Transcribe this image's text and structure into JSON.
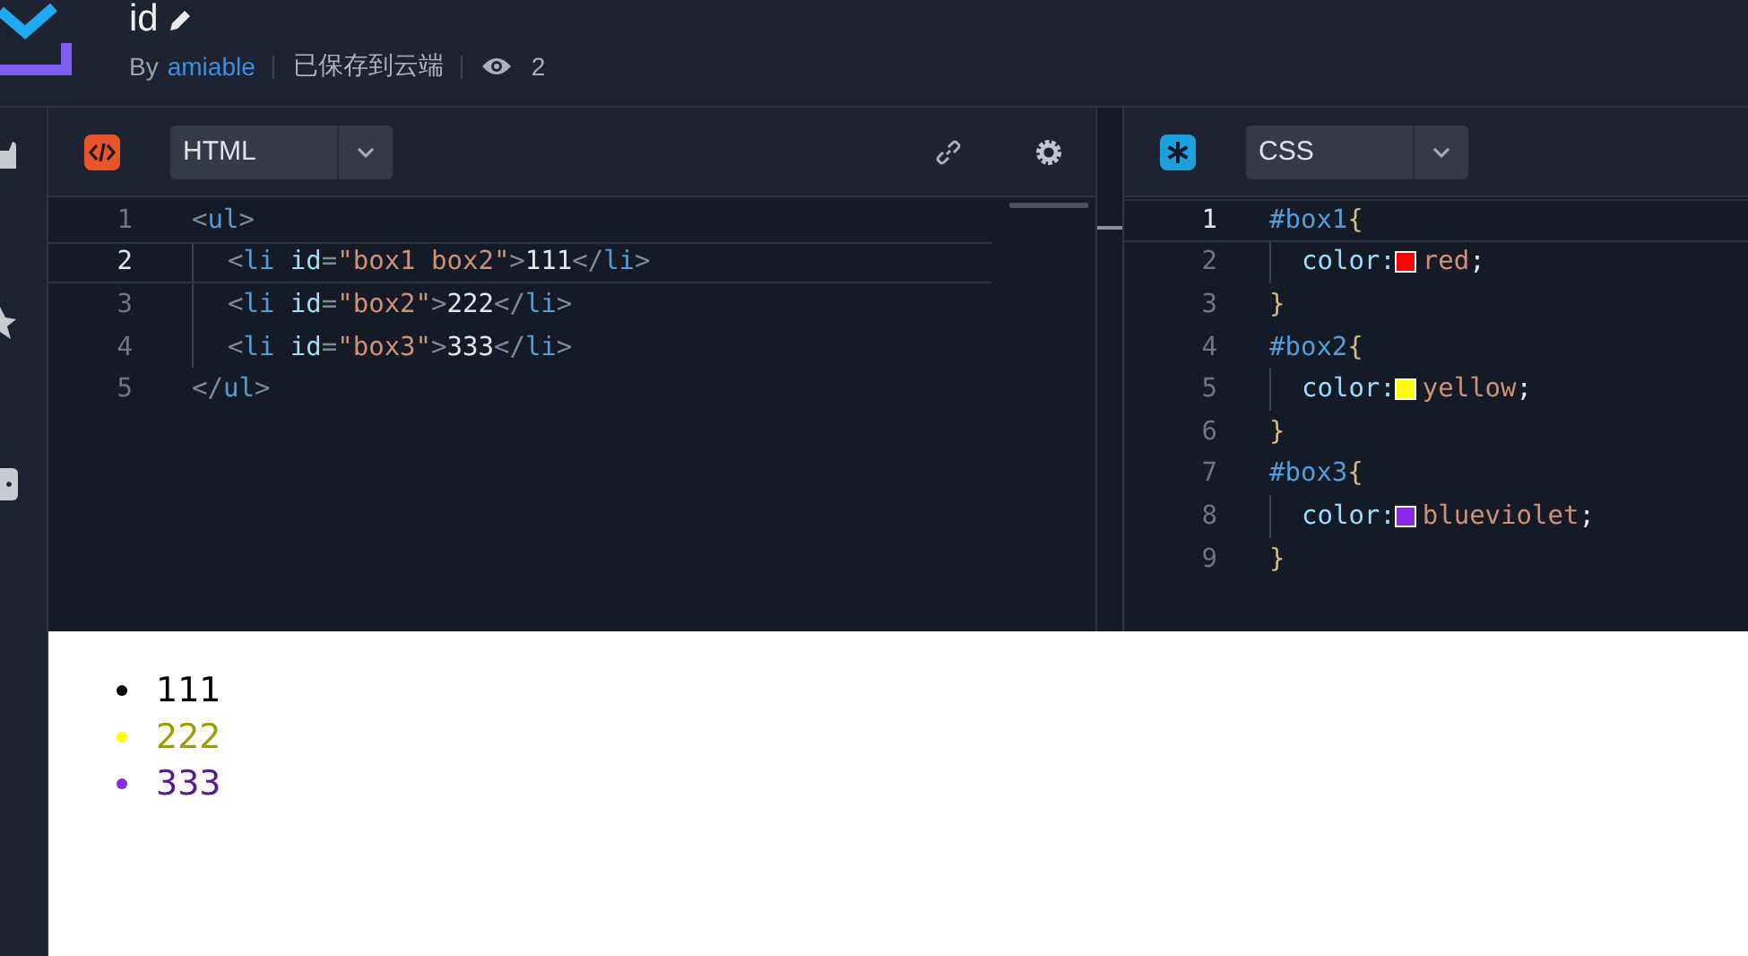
{
  "header": {
    "title": "id",
    "by_label": "By",
    "author": "amiable",
    "save_status": "已保存到云端",
    "views": "2"
  },
  "html_pane": {
    "language": "HTML",
    "lines": [
      {
        "number": "1",
        "active": false,
        "indented": false,
        "tokens": [
          {
            "kind": "punct",
            "text": "<"
          },
          {
            "kind": "tag",
            "text": "ul"
          },
          {
            "kind": "punct",
            "text": ">"
          }
        ]
      },
      {
        "number": "2",
        "active": true,
        "indented": true,
        "tokens": [
          {
            "kind": "punct",
            "text": "<"
          },
          {
            "kind": "tag",
            "text": "li"
          },
          {
            "kind": "attr",
            "text": " id"
          },
          {
            "kind": "punct",
            "text": "="
          },
          {
            "kind": "str",
            "text": "\"box1 box2\""
          },
          {
            "kind": "punct",
            "text": ">"
          },
          {
            "kind": "text",
            "text": "111"
          },
          {
            "kind": "punct",
            "text": "</"
          },
          {
            "kind": "tag",
            "text": "li"
          },
          {
            "kind": "punct",
            "text": ">"
          }
        ]
      },
      {
        "number": "3",
        "active": false,
        "indented": true,
        "tokens": [
          {
            "kind": "punct",
            "text": "<"
          },
          {
            "kind": "tag",
            "text": "li"
          },
          {
            "kind": "attr",
            "text": " id"
          },
          {
            "kind": "punct",
            "text": "="
          },
          {
            "kind": "str",
            "text": "\"box2\""
          },
          {
            "kind": "punct",
            "text": ">"
          },
          {
            "kind": "text",
            "text": "222"
          },
          {
            "kind": "punct",
            "text": "</"
          },
          {
            "kind": "tag",
            "text": "li"
          },
          {
            "kind": "punct",
            "text": ">"
          }
        ]
      },
      {
        "number": "4",
        "active": false,
        "indented": true,
        "tokens": [
          {
            "kind": "punct",
            "text": "<"
          },
          {
            "kind": "tag",
            "text": "li"
          },
          {
            "kind": "attr",
            "text": " id"
          },
          {
            "kind": "punct",
            "text": "="
          },
          {
            "kind": "str",
            "text": "\"box3\""
          },
          {
            "kind": "punct",
            "text": ">"
          },
          {
            "kind": "text",
            "text": "333"
          },
          {
            "kind": "punct",
            "text": "</"
          },
          {
            "kind": "tag",
            "text": "li"
          },
          {
            "kind": "punct",
            "text": ">"
          }
        ]
      },
      {
        "number": "5",
        "active": false,
        "indented": false,
        "tokens": [
          {
            "kind": "punct",
            "text": "</"
          },
          {
            "kind": "tag",
            "text": "ul"
          },
          {
            "kind": "punct",
            "text": ">"
          }
        ]
      }
    ]
  },
  "css_pane": {
    "language": "CSS",
    "lines": [
      {
        "number": "1",
        "active": true,
        "indented": false,
        "tokens": [
          {
            "kind": "sel",
            "text": "#box1"
          },
          {
            "kind": "brace",
            "text": "{"
          }
        ]
      },
      {
        "number": "2",
        "active": false,
        "indented": true,
        "tokens": [
          {
            "kind": "attr",
            "text": "color:"
          },
          {
            "kind": "swatch",
            "color": "#ff0000"
          },
          {
            "kind": "str",
            "text": "red"
          },
          {
            "kind": "text",
            "text": ";"
          }
        ]
      },
      {
        "number": "3",
        "active": false,
        "indented": false,
        "tokens": [
          {
            "kind": "brace",
            "text": "}"
          }
        ]
      },
      {
        "number": "4",
        "active": false,
        "indented": false,
        "tokens": [
          {
            "kind": "sel",
            "text": "#box2"
          },
          {
            "kind": "brace",
            "text": "{"
          }
        ]
      },
      {
        "number": "5",
        "active": false,
        "indented": true,
        "tokens": [
          {
            "kind": "attr",
            "text": "color:"
          },
          {
            "kind": "swatch",
            "color": "#ffff00"
          },
          {
            "kind": "str",
            "text": "yellow"
          },
          {
            "kind": "text",
            "text": ";"
          }
        ]
      },
      {
        "number": "6",
        "active": false,
        "indented": false,
        "tokens": [
          {
            "kind": "brace",
            "text": "}"
          }
        ]
      },
      {
        "number": "7",
        "active": false,
        "indented": false,
        "tokens": [
          {
            "kind": "sel",
            "text": "#box3"
          },
          {
            "kind": "brace",
            "text": "{"
          }
        ]
      },
      {
        "number": "8",
        "active": false,
        "indented": true,
        "tokens": [
          {
            "kind": "attr",
            "text": "color:"
          },
          {
            "kind": "swatch",
            "color": "#8a2be2"
          },
          {
            "kind": "str",
            "text": "blueviolet"
          },
          {
            "kind": "text",
            "text": ";"
          }
        ]
      },
      {
        "number": "9",
        "active": false,
        "indented": false,
        "tokens": [
          {
            "kind": "brace",
            "text": "}"
          }
        ]
      }
    ]
  },
  "preview": {
    "items": [
      {
        "text": "111",
        "color": "#000000"
      },
      {
        "text": "222",
        "color": "#ffff00"
      },
      {
        "text": "333",
        "color": "#8a2be2"
      }
    ]
  }
}
